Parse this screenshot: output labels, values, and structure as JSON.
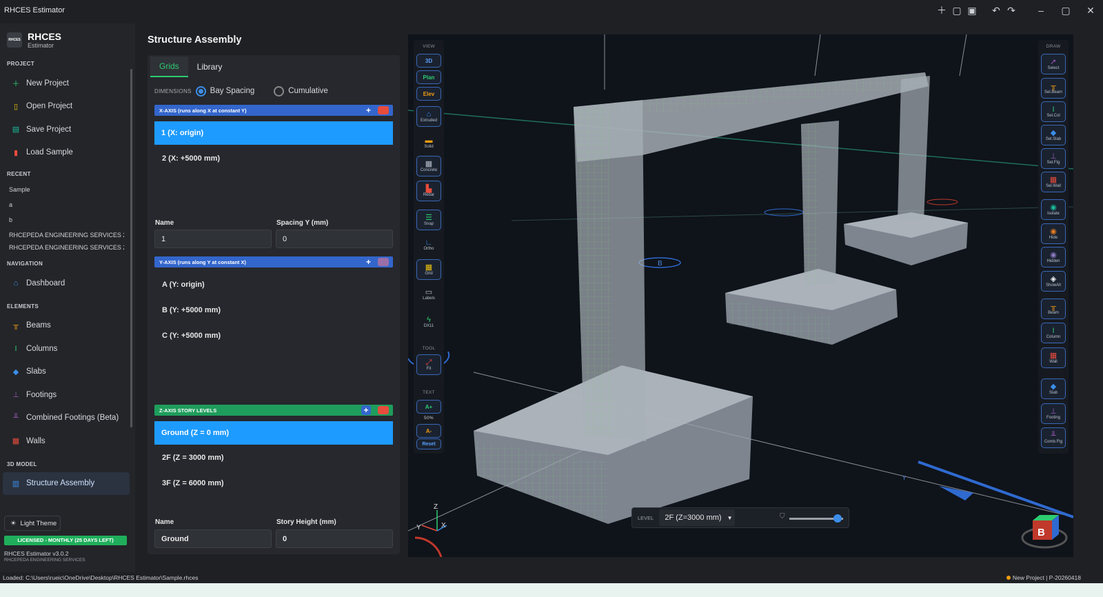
{
  "window": {
    "title": "RHCES Estimator"
  },
  "brand": {
    "name": "RHCES",
    "sub": "Estimator",
    "logo": "RHCES"
  },
  "sidebar": {
    "project_label": "PROJECT",
    "project_items": [
      {
        "label": "New Project",
        "icon": "plus-icon",
        "color": "#2ecc71"
      },
      {
        "label": "Open Project",
        "icon": "folder-icon",
        "color": "#f1c40f"
      },
      {
        "label": "Save Project",
        "icon": "save-icon",
        "color": "#1abc9c"
      },
      {
        "label": "Load Sample",
        "icon": "book-icon",
        "color": "#e74c3c"
      }
    ],
    "recent_label": "RECENT",
    "recent_items": [
      "Sample",
      "a",
      "b",
      "RHCEPEDA ENGINEERING SERVICES 2-...",
      "RHCEPEDA ENGINEERING SERVICES 2-..."
    ],
    "navigation_label": "NAVIGATION",
    "navigation_items": [
      {
        "label": "Dashboard",
        "icon": "home-icon"
      }
    ],
    "elements_label": "ELEMENTS",
    "element_items": [
      {
        "label": "Beams",
        "icon": "beam-icon",
        "color": "#f39c12"
      },
      {
        "label": "Columns",
        "icon": "column-icon",
        "color": "#2ecc71"
      },
      {
        "label": "Slabs",
        "icon": "slab-icon",
        "color": "#3b8eea"
      },
      {
        "label": "Footings",
        "icon": "footing-icon",
        "color": "#9b59b6"
      },
      {
        "label": "Combined Footings (Beta)",
        "icon": "combined-footing-icon",
        "color": "#9b59b6"
      },
      {
        "label": "Walls",
        "icon": "wall-icon",
        "color": "#e74c3c"
      }
    ],
    "model_label": "3D MODEL",
    "model_items": [
      {
        "label": "Structure Assembly",
        "icon": "structure-icon"
      }
    ],
    "theme_label": "Light Theme",
    "license": "LICENSED - MONTHLY (25 DAYS LEFT)",
    "version": "RHCES Estimator v3.0.2",
    "org": "RHCEPEDA ENGINEERING SERVICES"
  },
  "panel": {
    "title": "Structure Assembly",
    "tabs": [
      "Grids",
      "Library"
    ],
    "dimensions_label": "DIMENSIONS",
    "bay_spacing": "Bay Spacing",
    "cumulative": "Cumulative",
    "x_axis": {
      "header": "X-AXIS  (runs along X at constant Y)",
      "rows": [
        "1  (X: origin)",
        "2  (X: +5000 mm)"
      ],
      "name_label": "Name",
      "value_label": "Spacing Y (mm)",
      "name": "1",
      "value": "0"
    },
    "y_axis": {
      "header": "Y-AXIS  (runs along Y at constant X)",
      "rows": [
        "A  (Y: origin)",
        "B  (Y: +5000 mm)",
        "C  (Y: +5000 mm)"
      ]
    },
    "z_axis": {
      "header": "Z-AXIS  STORY LEVELS",
      "rows": [
        "Ground  (Z = 0 mm)",
        "2F  (Z = 3000 mm)",
        "3F  (Z = 6000 mm)"
      ],
      "name_label": "Name",
      "value_label": "Story Height (mm)",
      "name": "Ground",
      "value": "0"
    }
  },
  "view_toolbar": {
    "view_label": "VIEW",
    "views": [
      "3D",
      "Plan",
      "Elev"
    ],
    "tools": [
      {
        "label": "Extruded",
        "icon": "extruded-icon"
      },
      {
        "label": "Solid",
        "icon": "solid-icon"
      },
      {
        "label": "Concrete",
        "icon": "concrete-icon"
      },
      {
        "label": "Rebar",
        "icon": "rebar-icon"
      },
      {
        "label": "Snap",
        "icon": "snap-icon"
      },
      {
        "label": "Ortho",
        "icon": "ortho-icon"
      },
      {
        "label": "Grid",
        "icon": "grid-icon"
      },
      {
        "label": "Labels",
        "icon": "labels-icon"
      },
      {
        "label": "DX11",
        "icon": "dx11-icon"
      }
    ],
    "tool_label": "TOOL",
    "fit": "Fit",
    "text_label": "TEXT",
    "text_plus": "A+",
    "text_percent": "50%",
    "text_minus": "A-",
    "reset": "Reset"
  },
  "draw_toolbar": {
    "label": "DRAW",
    "items": [
      "Select",
      "Sel.Beam",
      "Sel.Col",
      "Sel.Slab",
      "Sel.Ftg",
      "Sel.Wall",
      "Isolate",
      "Hide",
      "Hidden",
      "ShowAll",
      "Beam",
      "Column",
      "Wall",
      "Slab",
      "Footing",
      "Comb.Ftg"
    ]
  },
  "viewport": {
    "level_label": "LEVEL",
    "level_value": "2F (Z=3000 mm)",
    "grid_label": "B",
    "axis_y_label": "Y",
    "triad": {
      "z": "Z",
      "y": "Y",
      "x": "X"
    },
    "cube_label": "B",
    "slider_value": 0.9
  },
  "status": {
    "loaded": "Loaded: C:\\Users\\rueic\\OneDrive\\Desktop\\RHCES Estimator\\Sample.rhces",
    "project": "New Project  |  P-20260418"
  }
}
